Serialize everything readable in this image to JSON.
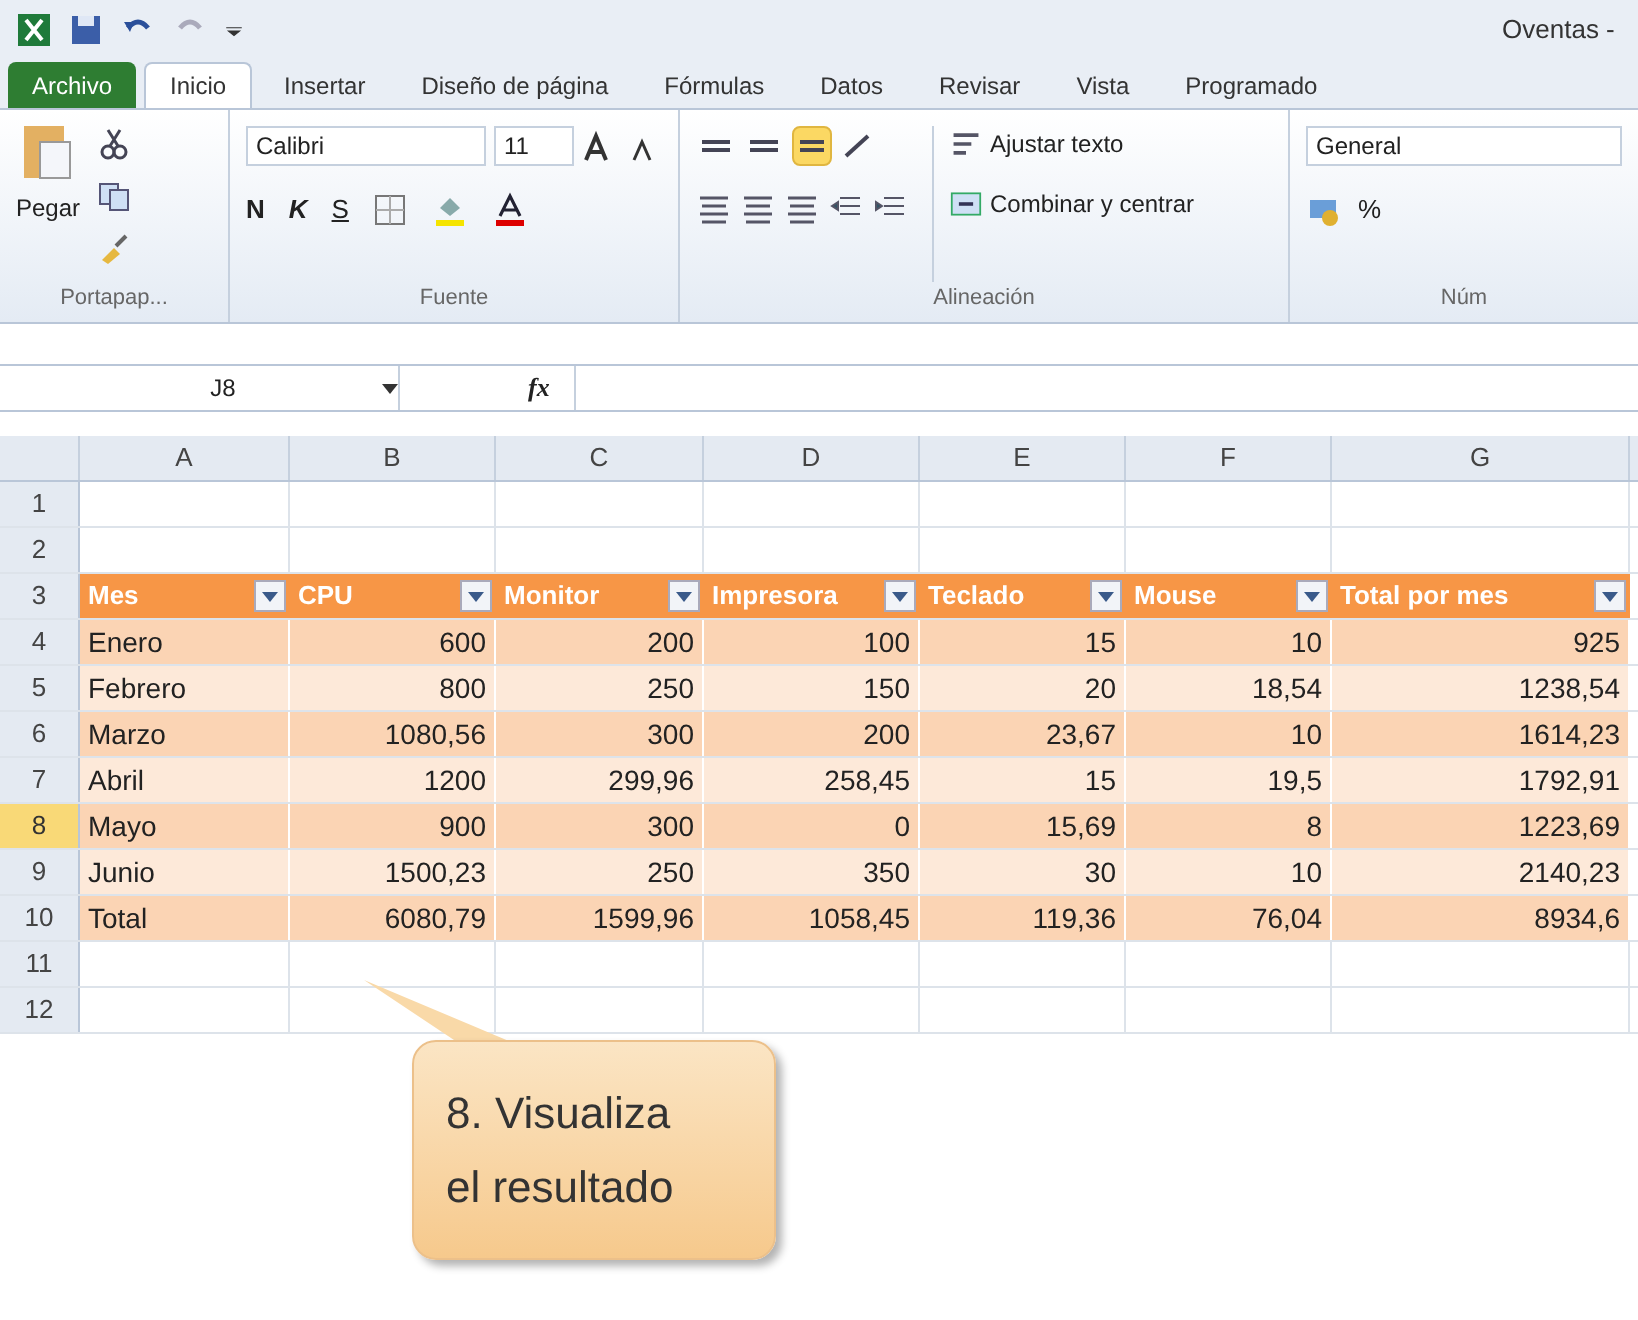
{
  "window": {
    "title": "Oventas - "
  },
  "tabs": [
    {
      "label": "Archivo",
      "kind": "file",
      "selected": false
    },
    {
      "label": "Inicio",
      "kind": "tab",
      "selected": true
    },
    {
      "label": "Insertar",
      "kind": "tab",
      "selected": false
    },
    {
      "label": "Diseño de página",
      "kind": "tab",
      "selected": false
    },
    {
      "label": "Fórmulas",
      "kind": "tab",
      "selected": false
    },
    {
      "label": "Datos",
      "kind": "tab",
      "selected": false
    },
    {
      "label": "Revisar",
      "kind": "tab",
      "selected": false
    },
    {
      "label": "Vista",
      "kind": "tab",
      "selected": false
    },
    {
      "label": "Programado",
      "kind": "tab",
      "selected": false
    }
  ],
  "ribbon": {
    "paste_label": "Pegar",
    "font_name": "Calibri",
    "font_size": "11",
    "bold": "N",
    "italic": "K",
    "underline": "S",
    "wrap_text": "Ajustar texto",
    "merge_center": "Combinar y centrar",
    "number_format": "General",
    "percent": "%",
    "align_buttons": [
      {
        "selected": false
      },
      {
        "selected": false
      },
      {
        "selected": true
      }
    ],
    "groups": [
      "Portapap...",
      "Fuente",
      "Alineación",
      "Núm"
    ]
  },
  "formula_bar": {
    "name_box": "J8",
    "fx": "fx"
  },
  "columns": [
    "A",
    "B",
    "C",
    "D",
    "E",
    "F",
    "G"
  ],
  "rows": [
    {
      "number": "1",
      "selected": false,
      "kind": "empty"
    },
    {
      "number": "2",
      "selected": false,
      "kind": "empty"
    },
    {
      "number": "3",
      "selected": false,
      "kind": "header",
      "cells": [
        "Mes",
        "CPU",
        "Monitor",
        "Impresora",
        "Teclado",
        "Mouse",
        "Total por mes"
      ]
    },
    {
      "number": "4",
      "selected": false,
      "kind": "data",
      "cells": [
        "Enero",
        "600",
        "200",
        "100",
        "15",
        "10",
        "925"
      ]
    },
    {
      "number": "5",
      "selected": false,
      "kind": "data",
      "cells": [
        "Febrero",
        "800",
        "250",
        "150",
        "20",
        "18,54",
        "1238,54"
      ]
    },
    {
      "number": "6",
      "selected": false,
      "kind": "data",
      "cells": [
        "Marzo",
        "1080,56",
        "300",
        "200",
        "23,67",
        "10",
        "1614,23"
      ]
    },
    {
      "number": "7",
      "selected": false,
      "kind": "data",
      "cells": [
        "Abril",
        "1200",
        "299,96",
        "258,45",
        "15",
        "19,5",
        "1792,91"
      ]
    },
    {
      "number": "8",
      "selected": true,
      "kind": "data",
      "cells": [
        "Mayo",
        "900",
        "300",
        "0",
        "15,69",
        "8",
        "1223,69"
      ]
    },
    {
      "number": "9",
      "selected": false,
      "kind": "data",
      "cells": [
        "Junio",
        "1500,23",
        "250",
        "350",
        "30",
        "10",
        "2140,23"
      ]
    },
    {
      "number": "10",
      "selected": false,
      "kind": "data",
      "cells": [
        "Total",
        "6080,79",
        "1599,96",
        "1058,45",
        "119,36",
        "76,04",
        "8934,6"
      ]
    },
    {
      "number": "11",
      "selected": false,
      "kind": "empty"
    },
    {
      "number": "12",
      "selected": false,
      "kind": "empty"
    }
  ],
  "callout": {
    "lines": [
      "8. Visualiza",
      "el resultado"
    ]
  }
}
